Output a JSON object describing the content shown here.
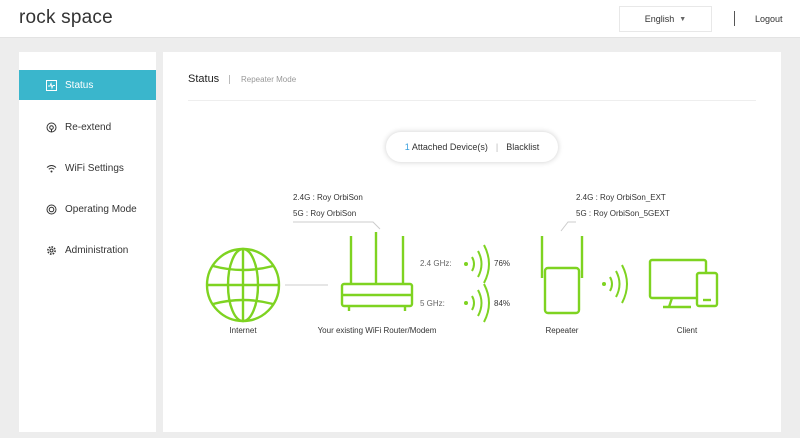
{
  "header": {
    "logo": "rock space",
    "language": "English",
    "logout": "Logout"
  },
  "sidebar": {
    "items": [
      {
        "label": "Status",
        "icon": "status-icon",
        "active": true
      },
      {
        "label": "Re-extend",
        "icon": "re-extend-icon",
        "active": false
      },
      {
        "label": "WiFi Settings",
        "icon": "wifi-icon",
        "active": false
      },
      {
        "label": "Operating Mode",
        "icon": "operating-mode-icon",
        "active": false
      },
      {
        "label": "Administration",
        "icon": "gear-icon",
        "active": false
      }
    ]
  },
  "main": {
    "title": "Status",
    "subtitle": "Repeater Mode",
    "devices": {
      "count": "1",
      "attached_label": "Attached Device(s)",
      "blacklist_label": "Blacklist"
    },
    "router": {
      "ssid_24": "2.4G :  Roy OrbiSon",
      "ssid_5": "5G :  Roy OrbiSon",
      "label": "Your existing WiFi Router/Modem"
    },
    "repeater": {
      "ssid_24": "2.4G :  Roy OrbiSon_EXT",
      "ssid_5": "5G :  Roy OrbiSon_5GEXT",
      "label": "Repeater"
    },
    "internet_label": "Internet",
    "client_label": "Client",
    "signal_24": {
      "band": "2.4 GHz:",
      "strength": "76%"
    },
    "signal_5": {
      "band": "5 GHz:",
      "strength": "84%"
    }
  },
  "colors": {
    "accent": "#3ab6cc",
    "device_green": "#7ed321",
    "count_blue": "#3a9fdc"
  }
}
